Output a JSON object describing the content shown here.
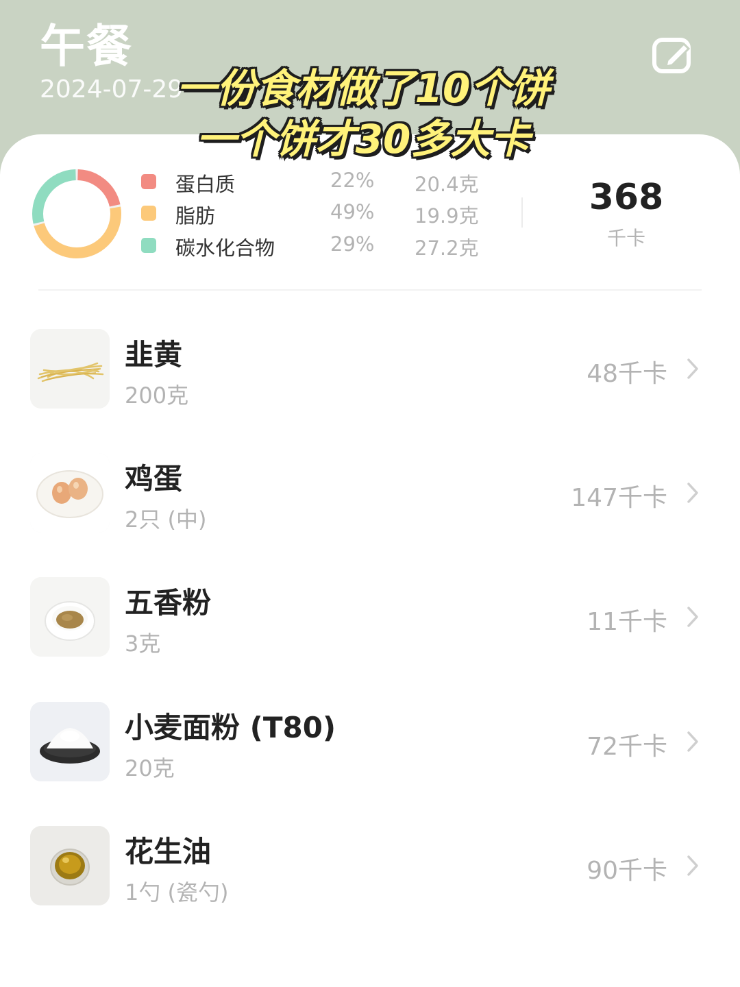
{
  "header": {
    "title": "午餐",
    "date": "2024-07-29",
    "edit_icon": "edit-icon"
  },
  "overlay_caption": {
    "line1": "一份食材做了10个饼",
    "line2": "一个饼才30多大卡"
  },
  "summary": {
    "macros": [
      {
        "name": "蛋白质",
        "percent": "22%",
        "amount": "20.4克",
        "color": "#f28b82"
      },
      {
        "name": "脂肪",
        "percent": "49%",
        "amount": "19.9克",
        "color": "#fcc97a"
      },
      {
        "name": "碳水化合物",
        "percent": "29%",
        "amount": "27.2克",
        "color": "#8fdcc0"
      }
    ],
    "total_kcal": "368",
    "total_unit": "千卡"
  },
  "foods": [
    {
      "name": "韭黄",
      "quantity": "200克",
      "kcal": "48千卡",
      "thumb": "yellow-chives-image"
    },
    {
      "name": "鸡蛋",
      "quantity": "2只 (中)",
      "kcal": "147千卡",
      "thumb": "eggs-image"
    },
    {
      "name": "五香粉",
      "quantity": "3克",
      "kcal": "11千卡",
      "thumb": "five-spice-powder-image"
    },
    {
      "name": "小麦面粉 (T80)",
      "quantity": "20克",
      "kcal": "72千卡",
      "thumb": "wheat-flour-image"
    },
    {
      "name": "花生油",
      "quantity": "1勺 (瓷勺)",
      "kcal": "90千卡",
      "thumb": "peanut-oil-image"
    }
  ]
}
